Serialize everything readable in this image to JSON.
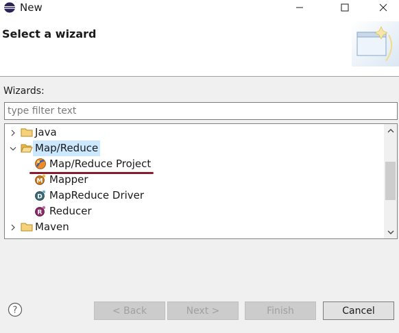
{
  "window": {
    "title": "New"
  },
  "header": {
    "title": "Select a wizard"
  },
  "wizards_label": "Wizards:",
  "filter": {
    "placeholder": "type filter text",
    "value": ""
  },
  "tree": {
    "items": [
      {
        "label": "Java",
        "expanded": false,
        "icon": "folder-icon"
      },
      {
        "label": "Map/Reduce",
        "expanded": true,
        "icon": "folder-open-icon",
        "selected": true
      },
      {
        "label": "Map/Reduce Project",
        "icon": "mapreduce-project-icon"
      },
      {
        "label": "Mapper",
        "icon": "mapper-icon"
      },
      {
        "label": "MapReduce Driver",
        "icon": "driver-icon"
      },
      {
        "label": "Reducer",
        "icon": "reducer-icon"
      },
      {
        "label": "Maven",
        "expanded": false,
        "icon": "folder-icon"
      }
    ]
  },
  "buttons": {
    "back": "< Back",
    "next": "Next >",
    "finish": "Finish",
    "cancel": "Cancel"
  },
  "colors": {
    "selection": "#cce8ff",
    "annotation_underline": "#8b1a2b",
    "folder": "#e8b84a"
  }
}
